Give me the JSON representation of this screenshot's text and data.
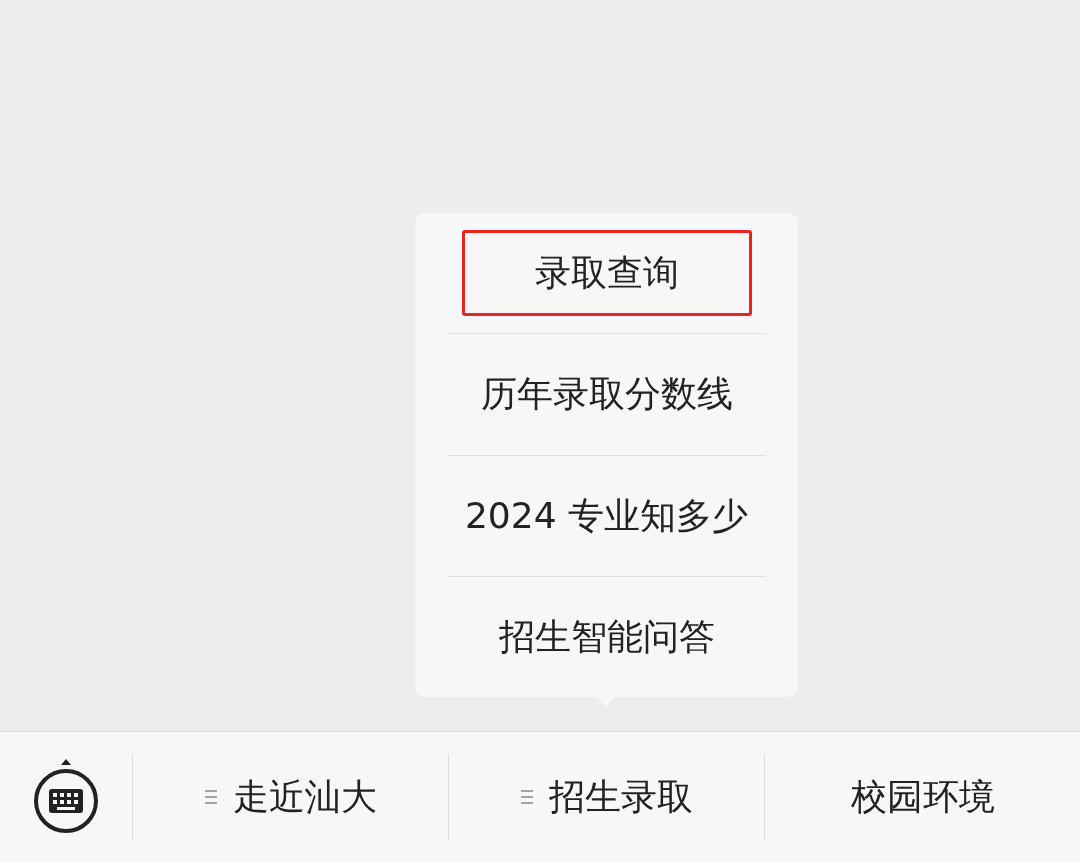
{
  "popup_menu": {
    "items": [
      {
        "label": "录取查询",
        "selected": true
      },
      {
        "label": "历年录取分数线",
        "selected": false
      },
      {
        "label": "2024 专业知多少",
        "selected": false
      },
      {
        "label": "招生智能问答",
        "selected": false
      }
    ]
  },
  "bottom_menu": {
    "tabs": [
      {
        "label": "走近汕大",
        "kind": "submenu"
      },
      {
        "label": "招生录取",
        "kind": "submenu"
      },
      {
        "label": "校园环境",
        "kind": "link"
      }
    ]
  }
}
